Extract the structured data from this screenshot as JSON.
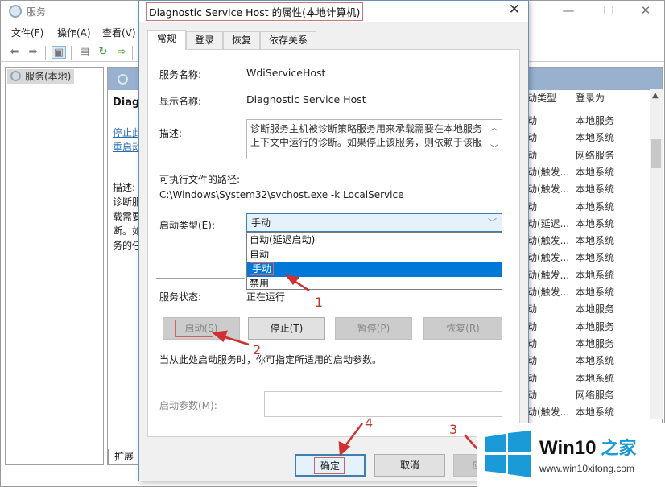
{
  "background_window": {
    "title": "服务",
    "window_controls": {
      "minimize": "—",
      "maximize": "☐",
      "close": "✕"
    },
    "menu": [
      "文件(F)",
      "操作(A)",
      "查看(V)"
    ],
    "toolbar_icons": [
      "back-arrow-icon",
      "forward-arrow-icon",
      "console-tree-icon",
      "properties-icon",
      "refresh-icon",
      "export-list-icon"
    ],
    "tree": {
      "root_label": "服务(本地)"
    },
    "detail": {
      "title_partial": "Diagr",
      "links": [
        "停止此",
        "重启动"
      ],
      "desc_lines": [
        "描述:",
        "诊断服",
        "载需要",
        "断。如",
        "务的任"
      ]
    },
    "list": {
      "columns": [
        "动类型",
        "登录为"
      ],
      "rows": [
        [
          "动",
          "本地服务"
        ],
        [
          "动",
          "本地系统"
        ],
        [
          "动",
          "网络服务"
        ],
        [
          "动(触发...",
          "本地系统"
        ],
        [
          "动(触发...",
          "本地系统"
        ],
        [
          "动",
          "本地系统"
        ],
        [
          "动(延迟...",
          "本地系统"
        ],
        [
          "动(触发...",
          "本地系统"
        ],
        [
          "动(触发...",
          "本地系统"
        ],
        [
          "动(触发...",
          "本地系统"
        ],
        [
          "动(触发...",
          "本地系统"
        ],
        [
          "动",
          "本地服务"
        ],
        [
          "动",
          "本地服务"
        ],
        [
          "动",
          "本地服务"
        ],
        [
          "动",
          "本地系统"
        ],
        [
          "动",
          "本地系统"
        ],
        [
          "动",
          "网络服务"
        ],
        [
          "动(触发...",
          "本地系统"
        ]
      ]
    },
    "bottom_tab": "扩展"
  },
  "dialog": {
    "title": "Diagnostic Service Host 的属性(本地计算机)",
    "close_icon": "✕",
    "tabs": [
      "常规",
      "登录",
      "恢复",
      "依存关系"
    ],
    "active_tab": "常规",
    "service_name_label": "服务名称:",
    "service_name": "WdiServiceHost",
    "display_name_label": "显示名称:",
    "display_name": "Diagnostic Service Host",
    "description_label": "描述:",
    "description": "诊断服务主机被诊断策略服务用来承载需要在本地服务上下文中运行的诊断。如果停止该服务，则依赖于该服",
    "path_label": "可执行文件的路径:",
    "path": "C:\\Windows\\System32\\svchost.exe -k LocalService",
    "startup_type_label": "启动类型(E):",
    "startup_type_value": "手动",
    "startup_options": [
      "自动(延迟启动)",
      "自动",
      "手动",
      "禁用"
    ],
    "startup_selected_index": 2,
    "status_label": "服务状态:",
    "status_value": "正在运行",
    "buttons": {
      "start": "启动(S)",
      "stop": "停止(T)",
      "pause": "暂停(P)",
      "resume": "恢复(R)"
    },
    "hint": "当从此处启动服务时，你可指定所适用的启动参数。",
    "params_label": "启动参数(M):",
    "params_value": "",
    "footer": {
      "ok": "确定",
      "cancel": "取消",
      "apply": "应用(A)"
    }
  },
  "annotations": [
    "1",
    "2",
    "3",
    "4"
  ],
  "watermark": {
    "brand": "Win10",
    "brand_accent": "之家",
    "url": "www.win10xitong.com",
    "logo_color": "#1a9ad6"
  }
}
